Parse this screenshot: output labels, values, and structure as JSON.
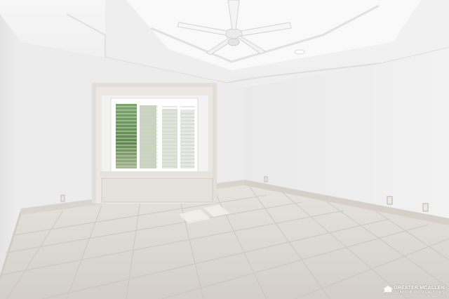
{
  "scene": {
    "description_colors": {
      "wall": "#ececec",
      "ceiling": "#f4f4f4",
      "floor": "#dcd8d2",
      "trim": "#d6d2cc",
      "window_frame": "#ffffff",
      "shutter": "#e9e9e9",
      "foliage": "#6e9a5a"
    }
  },
  "watermark": {
    "line1": "GREATER MCALLEN",
    "line2": "ASSOCIATION OF REALTORS"
  }
}
